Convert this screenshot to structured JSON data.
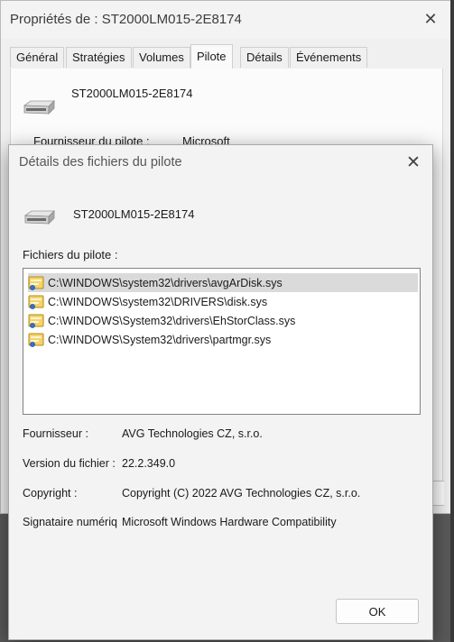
{
  "background_window": {
    "title": "Propriétés de : ST2000LM015-2E8174",
    "tabs": [
      "Général",
      "Stratégies",
      "Volumes",
      "Pilote",
      "Détails",
      "Événements"
    ],
    "active_tab": "Pilote",
    "device_name": "ST2000LM015-2E8174",
    "driver_provider_label": "Fournisseur du pilote :",
    "driver_provider_value": "Microsoft"
  },
  "dialog": {
    "title": "Détails des fichiers du pilote",
    "device_name": "ST2000LM015-2E8174",
    "files_label": "Fichiers du pilote :",
    "files": [
      "C:\\WINDOWS\\system32\\drivers\\avgArDisk.sys",
      "C:\\WINDOWS\\system32\\DRIVERS\\disk.sys",
      "C:\\WINDOWS\\System32\\drivers\\EhStorClass.sys",
      "C:\\WINDOWS\\System32\\drivers\\partmgr.sys"
    ],
    "selected_file_index": 0,
    "provider_label": "Fournisseur :",
    "provider_value": "AVG Technologies CZ, s.r.o.",
    "file_version_label": "Version du fichier :",
    "file_version_value": "22.2.349.0",
    "copyright_label": "Copyright :",
    "copyright_value": "Copyright (C) 2022 AVG Technologies CZ, s.r.o.",
    "signer_label": "Signataire numériq",
    "signer_value": "Microsoft Windows Hardware Compatibility",
    "ok_label": "OK"
  },
  "icons": {
    "device": "hard-drive-icon",
    "file": "driver-file-icon",
    "close": "close-icon"
  }
}
